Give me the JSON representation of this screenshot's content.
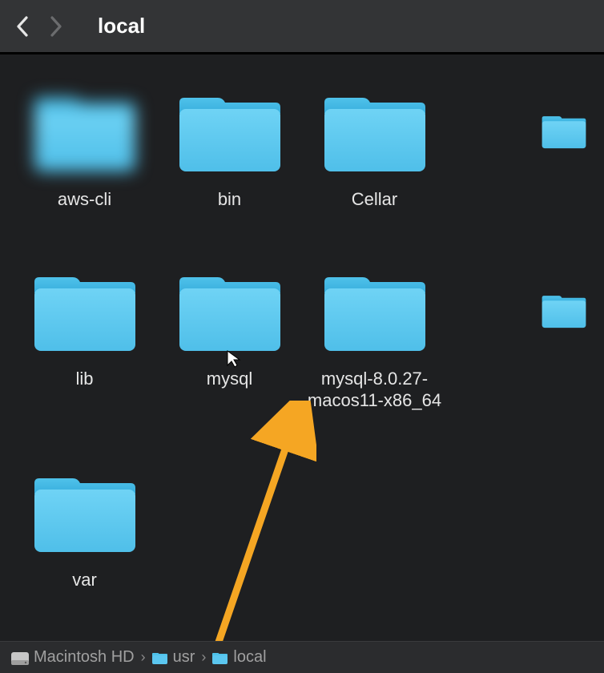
{
  "toolbar": {
    "title": "local"
  },
  "folders": [
    {
      "name": "aws-cli",
      "blurred": true
    },
    {
      "name": "bin"
    },
    {
      "name": "Cellar"
    },
    {
      "name": "",
      "partial": true
    },
    {
      "name": "lib"
    },
    {
      "name": "mysql"
    },
    {
      "name": "mysql-8.0.27-\nmacos11-x86_64"
    },
    {
      "name": "",
      "partial": true
    },
    {
      "name": "var"
    }
  ],
  "path": [
    {
      "label": "Macintosh HD",
      "icon": "disk"
    },
    {
      "label": "usr",
      "icon": "folder"
    },
    {
      "label": "local",
      "icon": "folder"
    }
  ],
  "colors": {
    "folder_fill": "#5bc7f0",
    "folder_tab": "#3db6e4",
    "accent_arrow": "#f5a623"
  }
}
